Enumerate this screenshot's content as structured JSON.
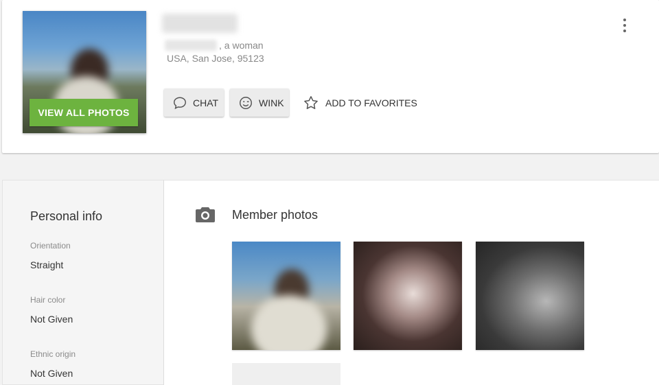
{
  "profile": {
    "gender_text": ", a woman",
    "location": "USA, San Jose, 95123",
    "view_all_photos": "VIEW ALL PHOTOS",
    "actions": {
      "chat": "CHAT",
      "wink": "WINK",
      "add_to_favorites": "ADD TO FAVORITES"
    }
  },
  "personal_info": {
    "title": "Personal info",
    "fields": [
      {
        "label": "Orientation",
        "value": "Straight"
      },
      {
        "label": "Hair color",
        "value": "Not Given"
      },
      {
        "label": "Ethnic origin",
        "value": "Not Given"
      }
    ]
  },
  "member_photos": {
    "title": "Member photos"
  },
  "colors": {
    "accent_green": "#6db33f",
    "page_background": "#f2f2f2",
    "muted_text": "#888888"
  },
  "icons": [
    "chat-bubble-icon",
    "wink-smiley-icon",
    "star-outline-icon",
    "more-vertical-icon",
    "camera-icon"
  ]
}
